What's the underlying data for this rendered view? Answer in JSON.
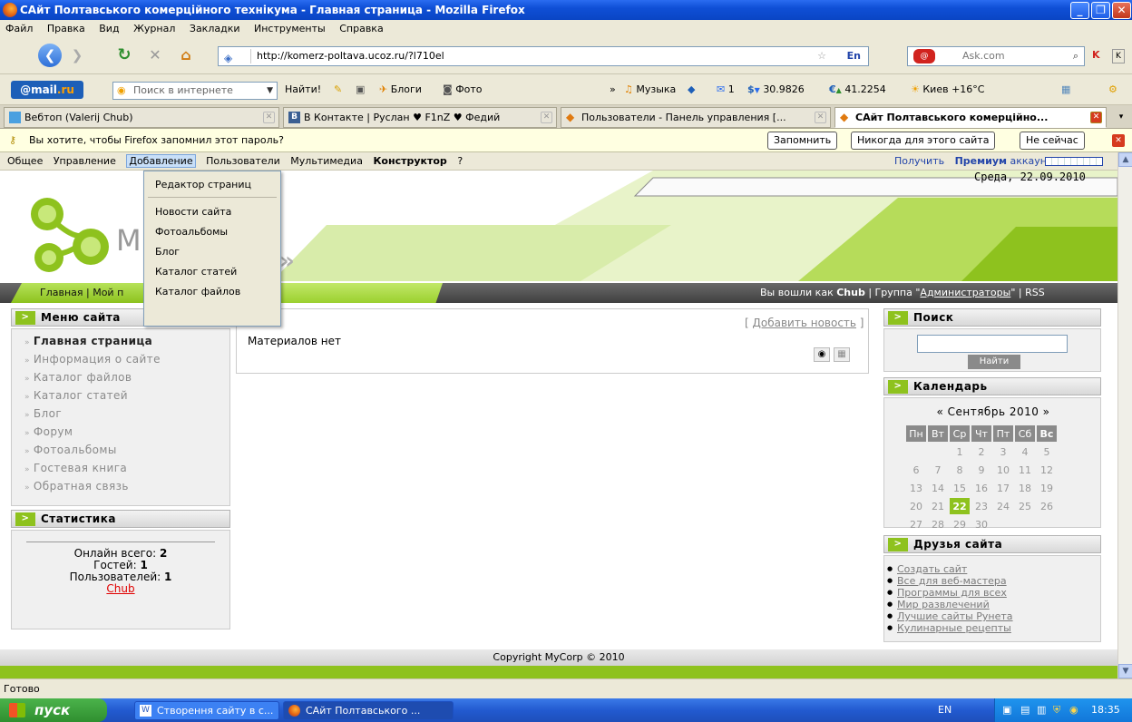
{
  "window": {
    "title": "САйт Полтавського комерційного технікума - Главная страница - Mozilla Firefox"
  },
  "menubar": [
    "Файл",
    "Правка",
    "Вид",
    "Журнал",
    "Закладки",
    "Инструменты",
    "Справка"
  ],
  "nav": {
    "url": "http://komerz-poltava.ucoz.ru/?l710el",
    "ask_placeholder": "Ask.com",
    "lang": "En"
  },
  "mailru": {
    "logo_a": "@mail",
    "logo_b": ".ru",
    "search_placeholder": "Поиск в интернете",
    "find": "Найти!",
    "blogs": "Блоги",
    "photo": "Фото",
    "more": "»",
    "music": "Музыка",
    "mail_count": "1",
    "usd": "30.9826",
    "eur": "41.2254",
    "weather": "Киев +16°C"
  },
  "tabs": [
    {
      "label": "Вебтоп (Valerij Chub)"
    },
    {
      "label": "В Контакте | Руслан ♥ F1nZ ♥ Федий"
    },
    {
      "label": "Пользователи - Панель управления [..."
    },
    {
      "label": "САйт Полтавського комерційно..."
    }
  ],
  "pwd": {
    "question": "Вы хотите, чтобы Firefox запомнил этот пароль?",
    "remember": "Запомнить",
    "never": "Никогда для этого сайта",
    "not_now": "Не сейчас"
  },
  "admin": {
    "items": [
      "Общее",
      "Управление",
      "Добавление",
      "Пользователи",
      "Мультимедиа",
      "Конструктор",
      "?"
    ],
    "premium_pre": "Получить",
    "premium_bold": "Премиум",
    "premium_post": "аккаунт"
  },
  "dropdown": [
    "Редактор страниц",
    "Новости сайта",
    "Фотоальбомы",
    "Блог",
    "Каталог статей",
    "Каталог файлов"
  ],
  "site": {
    "logo_letter": "M",
    "date": "Среда, 22.09.2010",
    "breadcrumb": "Главная | Мой п",
    "login_pre": "Вы вошли как",
    "login_user": "Chub",
    "login_group_pre": "| Группа \"",
    "login_group": "Администраторы",
    "login_post": "\" | RSS"
  },
  "menu_block": {
    "title": "Меню сайта",
    "items": [
      "Главная страница",
      "Информация о сайте",
      "Каталог файлов",
      "Каталог статей",
      "Блог",
      "Форум",
      "Фотоальбомы",
      "Гостевая книга",
      "Обратная связь"
    ]
  },
  "stats_block": {
    "title": "Статистика",
    "online_label": "Онлайн всего:",
    "online": "2",
    "guests_label": "Гостей:",
    "guests": "1",
    "users_label": "Пользователей:",
    "users": "1",
    "user": "Chub"
  },
  "content": {
    "add_news": "Добавить новость",
    "empty": "Материалов нет"
  },
  "search_block": {
    "title": "Поиск",
    "button": "Найти"
  },
  "calendar": {
    "title": "Календарь",
    "month": "« Сентябрь 2010 »",
    "days": [
      "Пн",
      "Вт",
      "Ср",
      "Чт",
      "Пт",
      "Сб",
      "Вс"
    ],
    "weeks": [
      [
        "",
        "",
        "1",
        "2",
        "3",
        "4",
        "5"
      ],
      [
        "6",
        "7",
        "8",
        "9",
        "10",
        "11",
        "12"
      ],
      [
        "13",
        "14",
        "15",
        "16",
        "17",
        "18",
        "19"
      ],
      [
        "20",
        "21",
        "22",
        "23",
        "24",
        "25",
        "26"
      ],
      [
        "27",
        "28",
        "29",
        "30",
        "",
        "",
        ""
      ]
    ],
    "today": "22"
  },
  "friends_block": {
    "title": "Друзья сайта",
    "links": [
      "Создать сайт",
      "Все для веб-мастера",
      "Программы для всех",
      "Мир развлечений",
      "Лучшие сайты Рунета",
      "Кулинарные рецепты"
    ]
  },
  "footer": "Copyright MyCorp © 2010",
  "status": "Готово",
  "taskbar": {
    "start": "пуск",
    "items": [
      "Створення сайту в с...",
      "САйт Полтавського ..."
    ],
    "lang": "EN",
    "time": "18:35"
  },
  "colors": {
    "accent_green": "#8ec21e",
    "xp_blue": "#0f4fd6"
  }
}
